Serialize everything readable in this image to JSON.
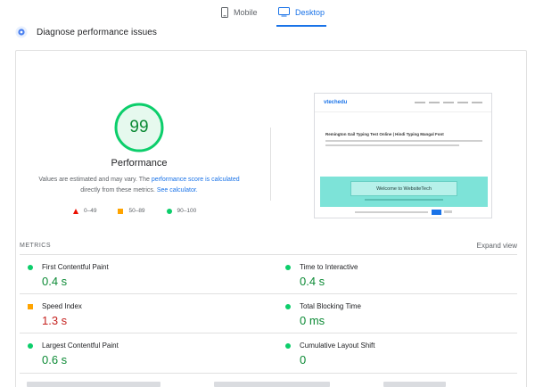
{
  "tabs": [
    {
      "label": "Mobile",
      "icon": "phone-icon",
      "active": false
    },
    {
      "label": "Desktop",
      "icon": "desktop-icon",
      "active": true
    }
  ],
  "diagnose": {
    "label": "Diagnose performance issues",
    "icon": "diagnose-icon"
  },
  "performance": {
    "score": "99",
    "title": "Performance",
    "desc_text_1": "Values are estimated and may vary. The ",
    "desc_link_1": "performance score is calculated",
    "desc_text_2": " directly from these metrics. ",
    "desc_link_2": "See calculator."
  },
  "legend": [
    {
      "range": "0–49",
      "shape": "triangle",
      "color": "#eb0f00"
    },
    {
      "range": "50–89",
      "shape": "square",
      "color": "#ffa400"
    },
    {
      "range": "90–100",
      "shape": "circle",
      "color": "#0cce6b"
    }
  ],
  "screenshot": {
    "logo": "vtechedu",
    "heading": "Remington Gail Typing Test Online | Hindi Typing Mangal Font",
    "banner_button": "Welcome to WebsiteTech"
  },
  "metrics": {
    "label": "METRICS",
    "expand": "Expand view",
    "items": [
      {
        "name": "First Contentful Paint",
        "value": "0.4 s",
        "status": "good"
      },
      {
        "name": "Time to Interactive",
        "value": "0.4 s",
        "status": "good"
      },
      {
        "name": "Speed Index",
        "value": "1.3 s",
        "status": "average"
      },
      {
        "name": "Total Blocking Time",
        "value": "0 ms",
        "status": "good"
      },
      {
        "name": "Largest Contentful Paint",
        "value": "0.6 s",
        "status": "good"
      },
      {
        "name": "Cumulative Layout Shift",
        "value": "0",
        "status": "good"
      }
    ]
  },
  "colors": {
    "accent": "#1a73e8",
    "good": "#0cce6b",
    "average": "#ffa400",
    "poor": "#eb0f00",
    "good_text": "#0c8a35",
    "bad_text": "#c5221f"
  }
}
